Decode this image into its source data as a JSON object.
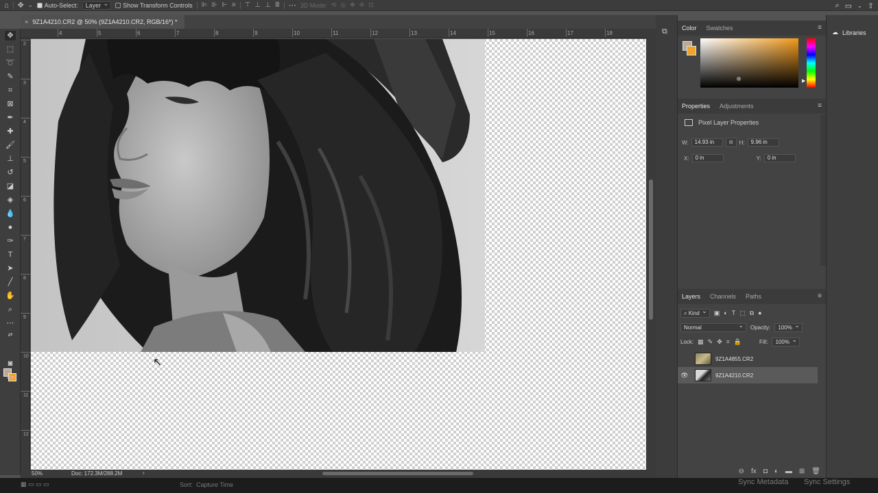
{
  "options_bar": {
    "auto_select_label": "Auto-Select:",
    "auto_select_target": "Layer",
    "show_transform_label": "Show Transform Controls",
    "mode_3d_label": "3D Mode:"
  },
  "document": {
    "tab_title": "9Z1A4210.CR2 @ 50% (9Z1A4210.CR2, RGB/16*) *"
  },
  "rulers": {
    "top": [
      "4",
      "5",
      "6",
      "7",
      "8",
      "9",
      "10",
      "11",
      "12",
      "13",
      "14",
      "15",
      "16",
      "17",
      "18"
    ],
    "left": [
      "2",
      "3",
      "4",
      "5",
      "6",
      "7",
      "8",
      "9",
      "10",
      "11",
      "12"
    ]
  },
  "status": {
    "zoom": "50%",
    "doc": "Doc: 172.3M/288.2M",
    "arrow": "›"
  },
  "bottom_strip": {
    "sort_label": "Sort:",
    "sort_value": "Capture Time",
    "sync_metadata": "Sync Metadata",
    "sync_settings": "Sync Settings"
  },
  "color_panel": {
    "tabs": [
      "Color",
      "Swatches"
    ],
    "fg_color": "#bdaa96",
    "bg_color": "#f0a22a"
  },
  "properties_panel": {
    "tabs": [
      "Properties",
      "Adjustments"
    ],
    "title": "Pixel Layer Properties",
    "w_label": "W:",
    "w_value": "14.93 in",
    "h_label": "H:",
    "h_value": "9.96 in",
    "x_label": "X:",
    "x_value": "0 in",
    "y_label": "Y:",
    "y_value": "0 in"
  },
  "layers_panel": {
    "tabs": [
      "Layers",
      "Channels",
      "Paths"
    ],
    "filter": "Kind",
    "blend_mode": "Normal",
    "opacity_label": "Opacity:",
    "opacity_value": "100%",
    "lock_label": "Lock:",
    "fill_label": "Fill:",
    "fill_value": "100%",
    "layers": [
      {
        "name": "9Z1A4855.CR2",
        "visible": false,
        "selected": false
      },
      {
        "name": "9Z1A4210.CR2",
        "visible": true,
        "selected": true
      }
    ]
  },
  "libraries": {
    "label": "Libraries"
  }
}
